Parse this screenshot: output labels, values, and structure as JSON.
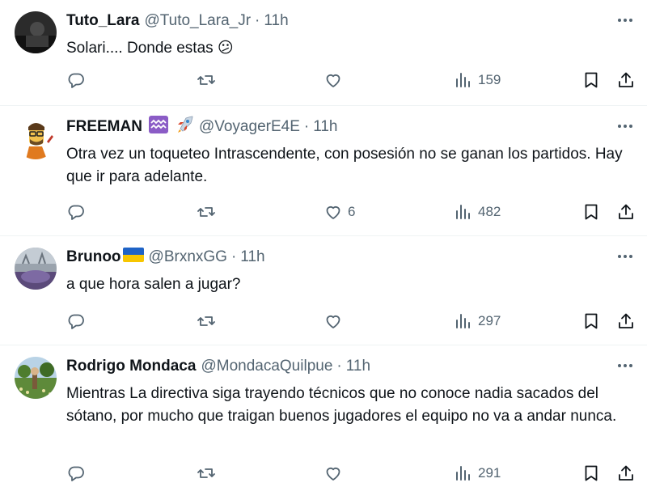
{
  "tweets": [
    {
      "name": "Tuto_Lara",
      "handle": "@Tuto_Lara_Jr",
      "time": "11h",
      "text": "Solari.... Donde estas 😕",
      "likes": "",
      "views": "159",
      "avatar_icon": "dark-photo-avatar"
    },
    {
      "name": "FREEMAN",
      "badges": [
        "♒",
        "🚀"
      ],
      "handle": "@VoyagerE4E",
      "time": "11h",
      "text": "Otra vez un toqueteo Intrascendente, con posesión no se ganan los partidos. Hay que ir para adelante.",
      "likes": "6",
      "views": "482",
      "avatar_icon": "cartoon-freeman-avatar"
    },
    {
      "name": "Brunoo",
      "badges": [
        "ukraine-flag"
      ],
      "handle": "@BrxnxGG",
      "time": "11h",
      "text": "a que hora salen a jugar?",
      "likes": "",
      "views": "297",
      "avatar_icon": "grey-photo-avatar"
    },
    {
      "name": "Rodrigo Mondaca",
      "handle": "@MondacaQuilpue",
      "time": "11h",
      "text": "Mientras La directiva siga trayendo técnicos que no conoce nadia sacados del sótano, por mucho que traigan buenos jugadores el equipo no va a andar nunca.",
      "likes": "",
      "views": "291",
      "avatar_icon": "garden-photo-avatar"
    }
  ],
  "separator": "·",
  "colors": {
    "text": "#0f1419",
    "secondary": "#536471",
    "divider": "#eff3f4"
  }
}
